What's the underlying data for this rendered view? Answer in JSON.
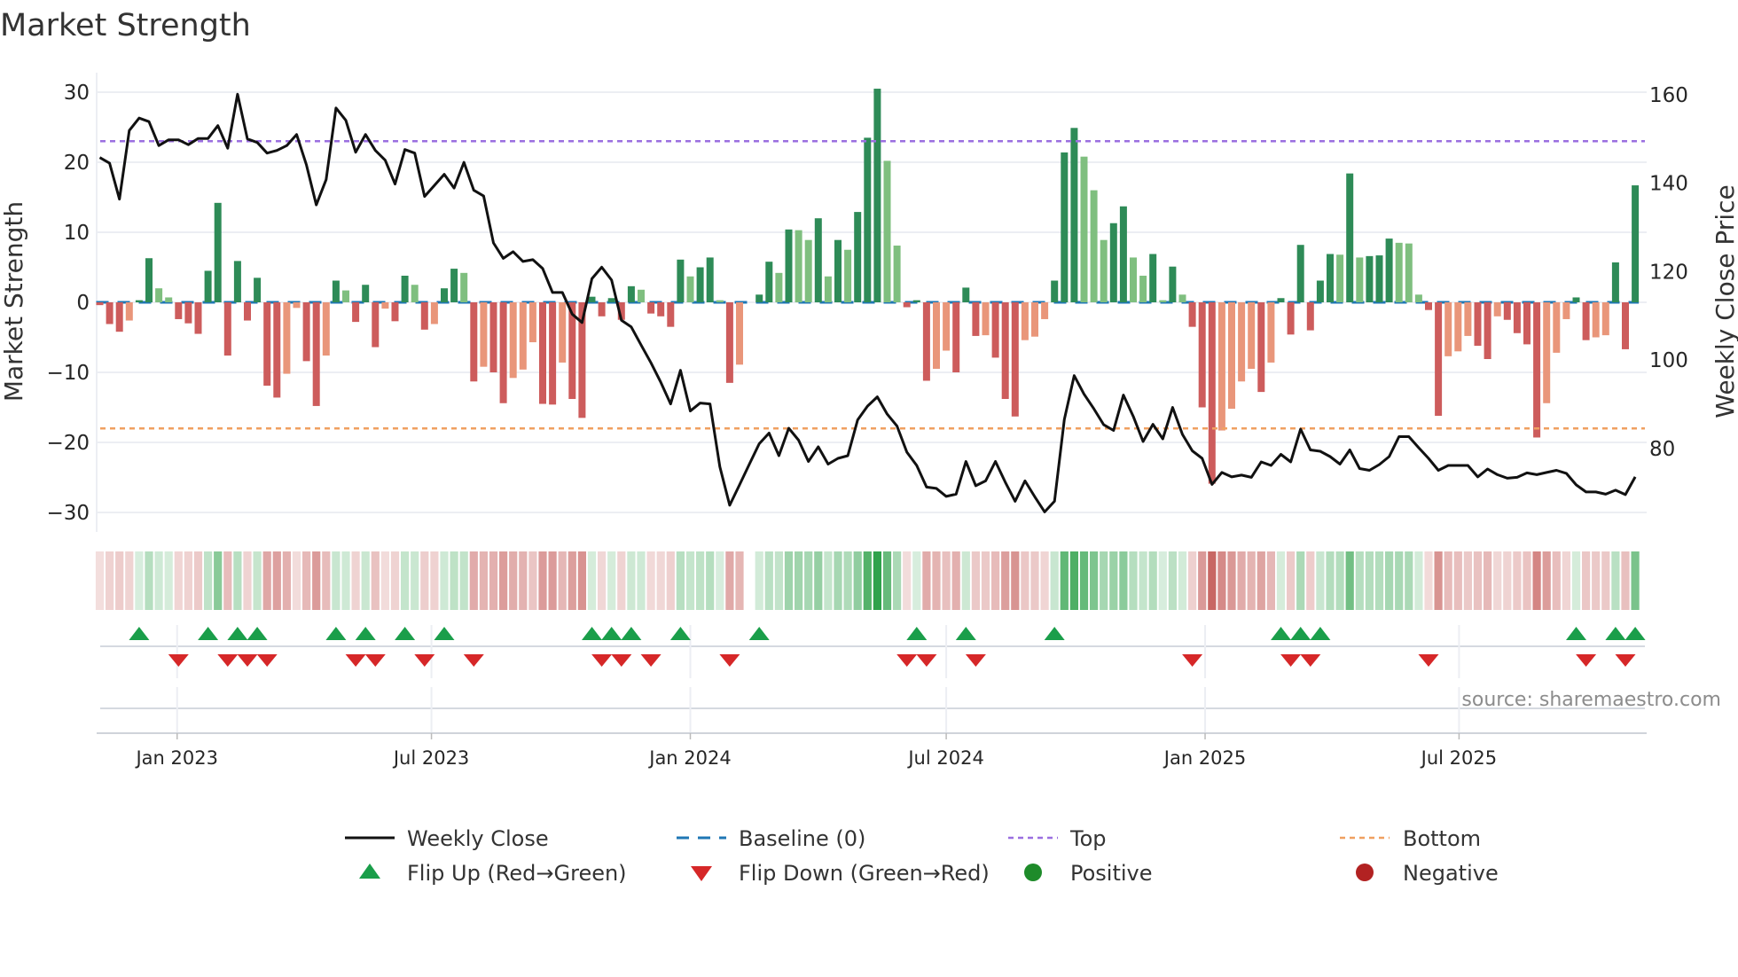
{
  "title": "Market Strength",
  "source": "source: sharemaestro.com",
  "colors": {
    "strong_green": "#2e8b57",
    "weak_green": "#7fbf7f",
    "strong_red": "#cd5c5c",
    "weak_red": "#e9967a",
    "heat_green": "#2ca048",
    "heat_red": "#c0504d",
    "baseline": "#1f77b4",
    "top": "#9b6fe0",
    "bottom": "#f0a060",
    "price": "#111111",
    "flip_up": "#1a9e4a",
    "flip_down": "#d62728",
    "positive": "#1e8b2a",
    "negative": "#b22222"
  },
  "chart_data": {
    "type": "bar",
    "title": "Market Strength",
    "ylabel": "Market Strength",
    "ylabel_right": "Weekly Close Price",
    "xlabel": "",
    "ylim": [
      -32,
      32
    ],
    "ylim_right": [
      64,
      163
    ],
    "y_ticks": [
      {
        "value": 30,
        "label": "30"
      },
      {
        "value": 20,
        "label": "20"
      },
      {
        "value": 10,
        "label": "10"
      },
      {
        "value": 0,
        "label": "0"
      },
      {
        "value": -10,
        "label": "−10"
      },
      {
        "value": -20,
        "label": "−20"
      },
      {
        "value": -30,
        "label": "−30"
      }
    ],
    "y_ticks_right": [
      {
        "value": 160,
        "label": "160"
      },
      {
        "value": 140,
        "label": "140"
      },
      {
        "value": 120,
        "label": "120"
      },
      {
        "value": 100,
        "label": "100"
      },
      {
        "value": 80,
        "label": "80"
      }
    ],
    "x_unit": "weeks since first bar",
    "x_ticks": [
      {
        "week": 7.86,
        "label": "Jan 2023"
      },
      {
        "week": 33.7,
        "label": "Jul 2023"
      },
      {
        "week": 60.0,
        "label": "Jan 2024"
      },
      {
        "week": 86.0,
        "label": "Jul 2024"
      },
      {
        "week": 112.3,
        "label": "Jan 2025"
      },
      {
        "week": 138.1,
        "label": "Jul 2025"
      }
    ],
    "baseline": 0,
    "top_threshold": 23,
    "bottom_threshold": -18,
    "strength": [
      -0.4,
      -3.1,
      -4.2,
      -2.6,
      0.3,
      6.3,
      2.0,
      0.7,
      -2.4,
      -3.0,
      -4.5,
      4.5,
      14.2,
      -7.6,
      5.9,
      -2.6,
      3.5,
      -11.9,
      -13.6,
      -10.2,
      -0.8,
      -8.4,
      -14.8,
      -7.6,
      3.1,
      1.7,
      -2.8,
      2.5,
      -6.4,
      -0.9,
      -2.7,
      3.8,
      2.5,
      -3.9,
      -3.1,
      2.0,
      4.8,
      4.2,
      -11.3,
      -9.2,
      -10.0,
      -14.4,
      -10.8,
      -9.6,
      -5.7,
      -14.5,
      -14.6,
      -8.6,
      -13.8,
      -16.5,
      0.8,
      -2.0,
      0.6,
      -2.5,
      2.3,
      1.8,
      -1.6,
      -2.0,
      -3.5,
      6.1,
      3.7,
      5.0,
      6.4,
      0.3,
      -11.5,
      -8.9,
      null,
      1.1,
      5.8,
      4.2,
      10.4,
      10.3,
      8.9,
      12.0,
      3.7,
      8.9,
      7.5,
      12.9,
      23.5,
      30.5,
      20.2,
      8.1,
      -0.7,
      0.3,
      -11.2,
      -9.5,
      -6.9,
      -10.0,
      2.1,
      -4.8,
      -4.7,
      -7.9,
      -13.8,
      -16.3,
      -5.4,
      -4.9,
      -2.4,
      3.1,
      21.4,
      24.9,
      20.8,
      16.0,
      8.9,
      11.3,
      13.7,
      6.4,
      3.8,
      6.9,
      0.3,
      5.1,
      1.1,
      -3.5,
      -15.0,
      -25.9,
      -18.3,
      -15.2,
      -11.3,
      -9.5,
      -12.8,
      -8.6,
      0.6,
      -4.6,
      8.2,
      -4.0,
      3.1,
      6.9,
      6.8,
      18.4,
      6.4,
      6.6,
      6.7,
      9.1,
      8.5,
      8.4,
      1.1,
      -1.1,
      -16.2,
      -7.7,
      -7.0,
      -4.8,
      -6.2,
      -8.1,
      -2.0,
      -2.5,
      -4.4,
      -6.0,
      -19.3,
      -14.4,
      -7.2,
      -2.4,
      0.7,
      -5.4,
      -5.0,
      -4.7,
      5.7,
      -6.7,
      16.7
    ],
    "weekly_close": [
      145.8,
      144.5,
      136.4,
      151.9,
      154.7,
      153.9,
      148.5,
      149.8,
      149.8,
      148.7,
      150.1,
      150.1,
      153.0,
      147.9,
      160.1,
      150.0,
      149.2,
      146.8,
      147.4,
      148.5,
      151.0,
      144.1,
      135.1,
      140.8,
      157.0,
      154.2,
      147.0,
      151.0,
      147.4,
      145.2,
      139.8,
      147.6,
      146.8,
      137.0,
      139.5,
      142.0,
      138.9,
      144.7,
      138.4,
      137.1,
      126.5,
      123.0,
      124.5,
      122.3,
      122.7,
      120.7,
      115.3,
      115.3,
      110.4,
      108.5,
      118.4,
      121.0,
      118.1,
      109.0,
      107.5,
      103.4,
      99.4,
      95.0,
      90.1,
      97.7,
      88.5,
      90.3,
      90.1,
      75.9,
      67.2,
      71.8,
      76.5,
      81.1,
      83.5,
      78.4,
      84.6,
      81.9,
      77.1,
      80.4,
      76.5,
      77.8,
      78.4,
      86.5,
      89.6,
      91.7,
      87.8,
      85.1,
      79.2,
      76.2,
      71.3,
      71.0,
      69.2,
      69.7,
      77.1,
      71.6,
      72.7,
      77.1,
      72.4,
      68.1,
      72.7,
      69.1,
      65.7,
      68.1,
      86.6,
      96.5,
      92.3,
      89.0,
      85.4,
      84.1,
      92.1,
      87.3,
      81.6,
      85.5,
      82.2,
      89.3,
      83.2,
      79.5,
      77.8,
      71.9,
      74.6,
      73.6,
      74.0,
      73.5,
      77.0,
      76.2,
      78.7,
      77.0,
      84.4,
      79.7,
      79.4,
      78.2,
      76.5,
      79.7,
      75.5,
      75.1,
      76.4,
      78.2,
      82.7,
      82.7,
      80.2,
      77.8,
      75.1,
      76.2,
      76.2,
      76.2,
      73.6,
      75.4,
      74.1,
      73.3,
      73.5,
      74.5,
      74.1,
      74.6,
      75.1,
      74.4,
      71.8,
      70.2,
      70.2,
      69.7,
      70.6,
      69.6,
      73.6
    ],
    "flip_up": [
      4,
      11,
      14,
      16,
      24,
      27,
      31,
      35,
      50,
      52,
      54,
      59,
      67,
      83,
      88,
      97,
      120,
      122,
      124,
      150,
      154,
      156
    ],
    "flip_down": [
      8,
      13,
      15,
      17,
      26,
      28,
      33,
      38,
      51,
      53,
      56,
      64,
      82,
      84,
      89,
      111,
      121,
      123,
      135,
      151,
      155
    ],
    "legend_position": "bottom",
    "legend": [
      {
        "label": "Weekly Close",
        "kind": "line"
      },
      {
        "label": "Baseline (0)",
        "kind": "dash"
      },
      {
        "label": "Top",
        "kind": "dot-top"
      },
      {
        "label": "Bottom",
        "kind": "dot-bottom"
      },
      {
        "label": "Flip Up (Red→Green)",
        "kind": "tri-up"
      },
      {
        "label": "Flip Down (Green→Red)",
        "kind": "tri-down"
      },
      {
        "label": "Positive",
        "kind": "circle-pos"
      },
      {
        "label": "Negative",
        "kind": "circle-neg"
      }
    ]
  }
}
